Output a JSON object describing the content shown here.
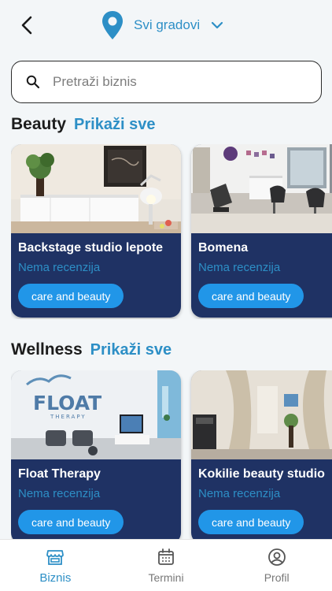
{
  "header": {
    "city_label": "Svi gradovi"
  },
  "search": {
    "placeholder": "Pretraži biznis"
  },
  "sections": [
    {
      "title": "Beauty",
      "more_label": "Prikaži sve",
      "cards": [
        {
          "name": "Backstage studio lepote",
          "reviews": "Nema recenzija",
          "tag": "care and beauty"
        },
        {
          "name": "Bomena",
          "reviews": "Nema recenzija",
          "tag": "care and beauty"
        }
      ]
    },
    {
      "title": "Wellness",
      "more_label": "Prikaži sve",
      "cards": [
        {
          "name": "Float Therapy",
          "reviews": "Nema recenzija",
          "tag": "care and beauty",
          "photo_text": "FLOAT",
          "photo_subtext": "THERAPY"
        },
        {
          "name": "Kokilie beauty studio",
          "reviews": "Nema recenzija",
          "tag": "care and beauty"
        }
      ]
    }
  ],
  "tabbar": {
    "items": [
      {
        "label": "Biznis",
        "icon": "store-icon",
        "active": true
      },
      {
        "label": "Termini",
        "icon": "calendar-icon",
        "active": false
      },
      {
        "label": "Profil",
        "icon": "user-circle-icon",
        "active": false
      }
    ]
  },
  "colors": {
    "accent": "#2d8fc6",
    "card_bg": "#1f3264",
    "tag_bg": "#2196e8"
  }
}
